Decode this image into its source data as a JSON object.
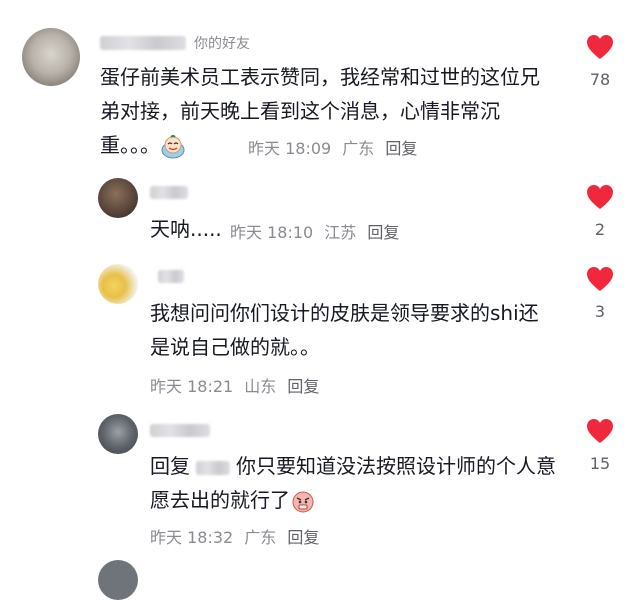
{
  "theme": {
    "heart_color": "#f0283c",
    "meta_color": "#8a8b91",
    "text_color": "#161823"
  },
  "comment": {
    "friend_tag": "你的好友",
    "text": "蛋仔前美术员工表示赞同，我经常和过世的这位兄弟对接，前天晚上看到这个消息，心情非常沉重。。。",
    "emoji": "crying-face-emoji",
    "time": "昨天 18:09",
    "location": "广东",
    "reply_label": "回复",
    "likes": "78"
  },
  "replies": [
    {
      "text": "天呐.....",
      "time": "昨天 18:10",
      "location": "江苏",
      "reply_label": "回复",
      "likes": "2"
    },
    {
      "text": "我想问问你们设计的皮肤是领导要求的shi还是说自己做的就。。",
      "time": "昨天 18:21",
      "location": "山东",
      "reply_label": "回复",
      "likes": "3"
    },
    {
      "reply_prefix": "回复",
      "text": "你只要知道没法按照设计师的个人意愿去出的就行了",
      "emoji": "angry-face-emoji",
      "time": "昨天 18:32",
      "location": "广东",
      "reply_label": "回复",
      "likes": "15"
    }
  ]
}
